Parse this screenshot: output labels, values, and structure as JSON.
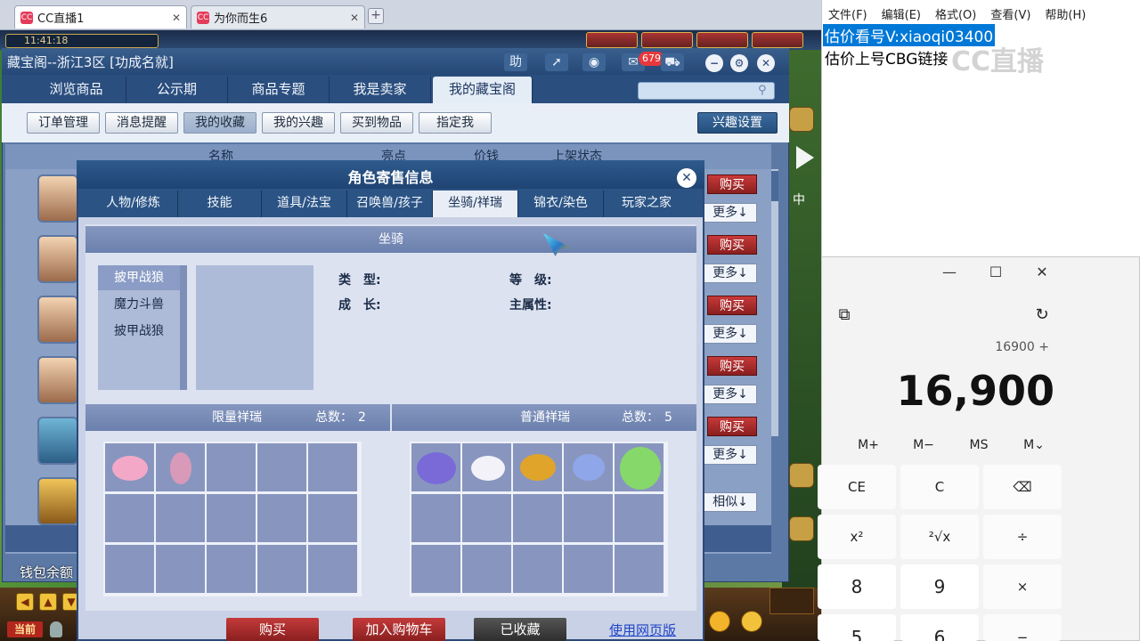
{
  "browser": {
    "tabs": [
      {
        "title": "CC直播1",
        "active": true
      },
      {
        "title": "为你而生6",
        "active": false
      }
    ],
    "close_glyph": "✕",
    "newtab_glyph": "+"
  },
  "game": {
    "clock": "11:41:18",
    "wallet_label": "钱包余额",
    "current_btn": "当前"
  },
  "panel": {
    "title": "藏宝阁--浙江3区 [功成名就]",
    "help_label": "助",
    "badge_count": "679",
    "nav_tabs": [
      "浏览商品",
      "公示期",
      "商品专题",
      "我是卖家",
      "我的藏宝阁"
    ],
    "sub_buttons": [
      "订单管理",
      "消息提醒",
      "我的收藏",
      "我的兴趣",
      "买到物品",
      "指定我"
    ],
    "interest_settings": "兴趣设置",
    "table_headers": [
      "名称",
      "亮点",
      "价钱",
      "上架状态"
    ],
    "buy_label": "购买",
    "more_label": "更多↓",
    "similar_label": "相似↓",
    "side_char": "中"
  },
  "dialog": {
    "title": "角色寄售信息",
    "tabs": [
      "人物/修炼",
      "技能",
      "道具/法宝",
      "召唤兽/孩子",
      "坐骑/祥瑞",
      "锦衣/染色",
      "玩家之家"
    ],
    "selected_tab": 4,
    "mount_section": "坐骑",
    "mounts": [
      "披甲战狼",
      "魔力斗兽",
      "披甲战狼"
    ],
    "attrs": {
      "type_label": "类　型:",
      "level_label": "等　级:",
      "growth_label": "成　长:",
      "main_attr_label": "主属性:"
    },
    "limited": {
      "title": "限量祥瑞",
      "count_label": "总数：",
      "count": "2"
    },
    "normal": {
      "title": "普通祥瑞",
      "count_label": "总数：",
      "count": "5"
    },
    "buttons": {
      "buy": "购买",
      "add_cart": "加入购物车",
      "favorited": "已收藏",
      "web_version": "使用网页版"
    }
  },
  "notepad": {
    "menu": [
      "文件(F)",
      "编辑(E)",
      "格式(O)",
      "查看(V)",
      "帮助(H)"
    ],
    "line1": "估价看号V:xiaoqi03400",
    "line2": "估价上号CBG链接",
    "watermark": "CC直播"
  },
  "calculator": {
    "expression": "16900 +",
    "display": "16,900",
    "memory": [
      "M+",
      "M−",
      "MS",
      "M⌄"
    ],
    "keys": [
      "CE",
      "C",
      "⌫",
      "x²",
      "²√x",
      "÷",
      "8",
      "9",
      "×"
    ],
    "partial_keys": [
      "5",
      "6",
      "−"
    ]
  },
  "colors": {
    "accent_blue": "#2b5485",
    "buy_red": "#c73a3a",
    "highlight": "#0078d7"
  }
}
